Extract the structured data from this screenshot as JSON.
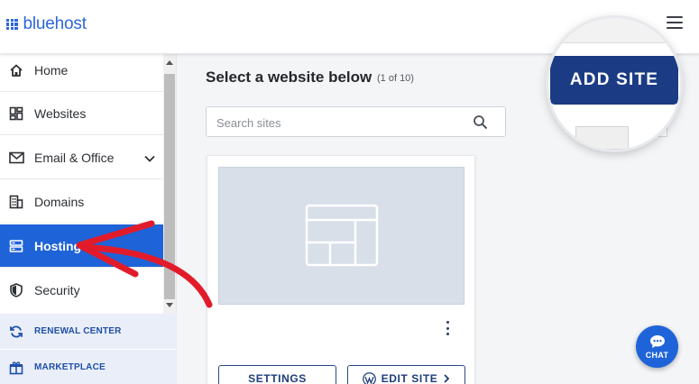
{
  "app": {
    "logo_text": "bluehost",
    "brand_color": "#2d67d7"
  },
  "header": {
    "menu_icon": "hamburger-menu-icon"
  },
  "sidebar": {
    "items": [
      {
        "label": "Home",
        "icon": "home-icon"
      },
      {
        "label": "Websites",
        "icon": "websites-grid-icon"
      },
      {
        "label": "Email & Office",
        "icon": "envelope-icon",
        "expandable": true
      },
      {
        "label": "Domains",
        "icon": "building-icon"
      },
      {
        "label": "Hosting",
        "icon": "server-icon",
        "active": true
      },
      {
        "label": "Security",
        "icon": "shield-icon"
      }
    ],
    "footer_items": [
      {
        "label": "RENEWAL CENTER",
        "icon": "refresh-icon"
      },
      {
        "label": "MARKETPLACE",
        "icon": "gift-icon"
      }
    ],
    "active_color": "#1f63d8"
  },
  "main": {
    "heading": "Select a website below",
    "count": "(1 of 10)",
    "search": {
      "placeholder": "Search sites",
      "value": ""
    },
    "site_card": {
      "settings_label": "SETTINGS",
      "edit_label": "EDIT SITE",
      "edit_icon": "wordpress-icon",
      "menu_icon": "kebab-menu-icon"
    }
  },
  "callout": {
    "add_site_label": "ADD SITE",
    "button_color": "#1b3c84"
  },
  "chat": {
    "label": "CHAT",
    "icon": "chat-bubble-icon"
  },
  "annotation": {
    "arrow_color": "#e21b2b",
    "points_to": "Hosting"
  }
}
